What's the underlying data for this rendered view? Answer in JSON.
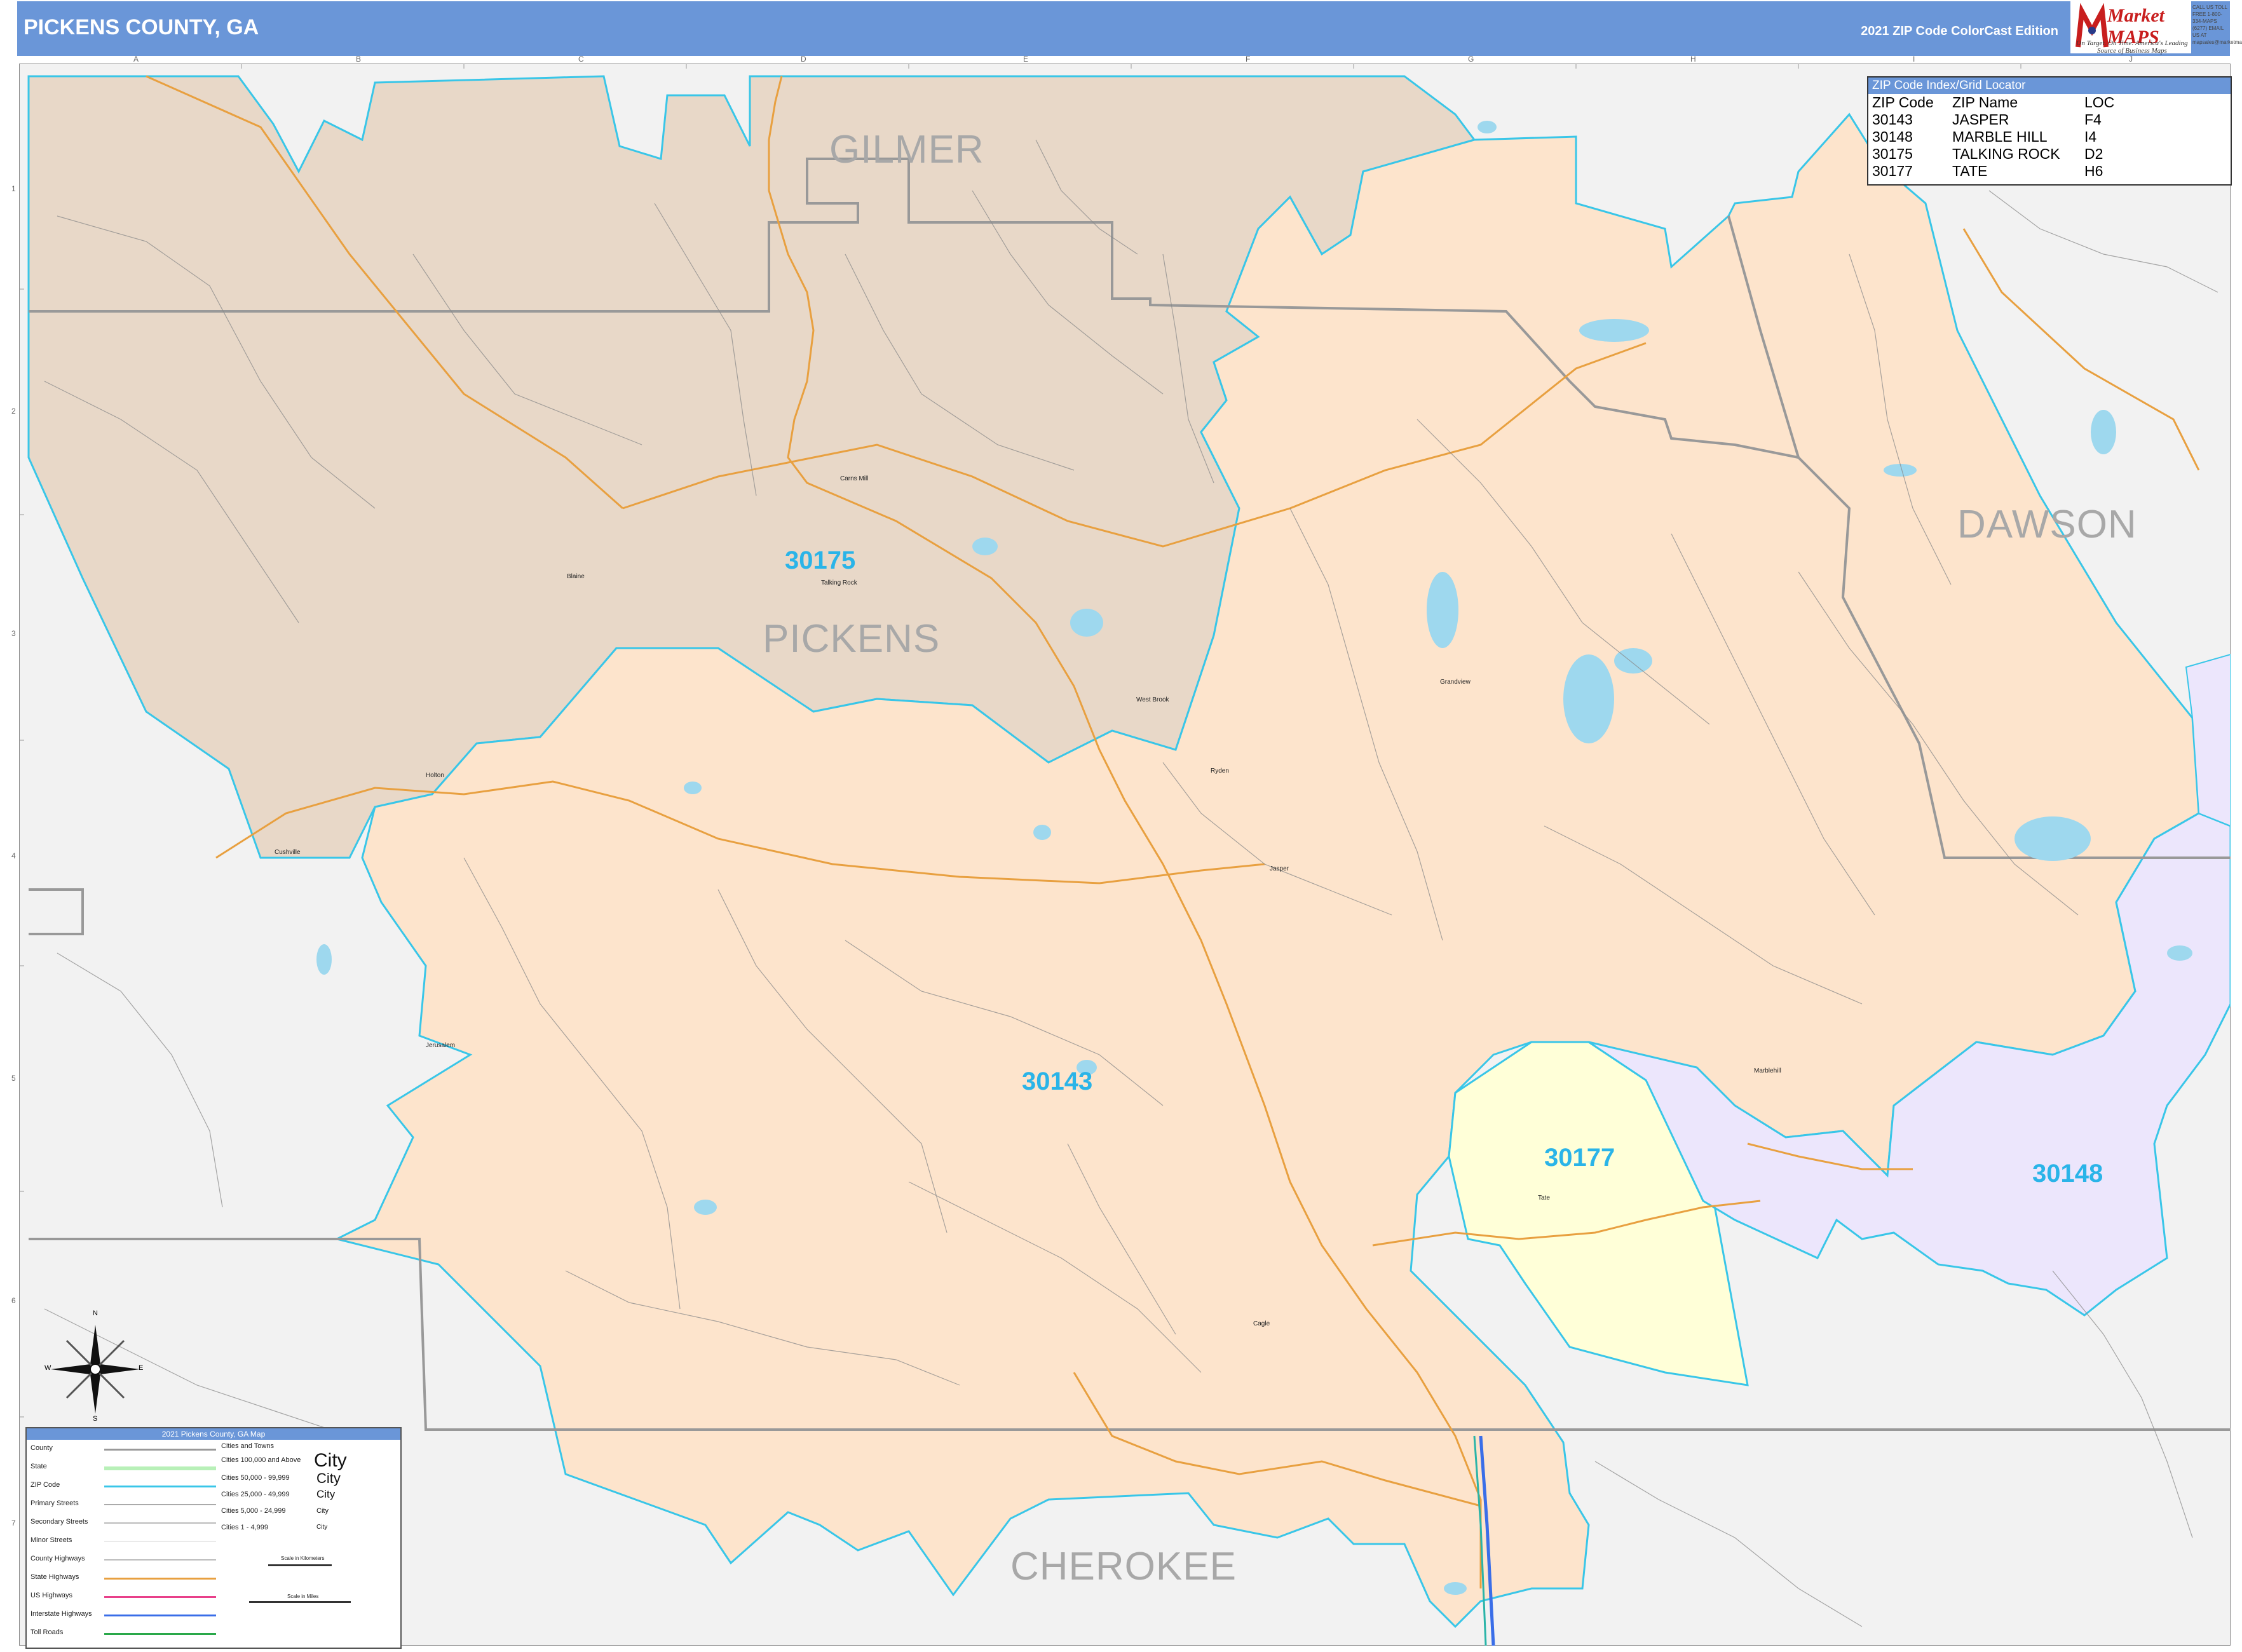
{
  "header": {
    "title": "PICKENS COUNTY, GA",
    "edition": "2021 ZIP Code ColorCast Edition",
    "logo_name": "Market MAPS",
    "logo_tagline": "On Target. On Time. America's Leading Source of Business Maps",
    "logo_contact": "CALL US TOLL FREE 1-800-334-MAPS (6277) EMAIL US AT mapsales@marketmaps.com"
  },
  "colors": {
    "header": "#6a96d8",
    "zip_30175": "#e8d8c8",
    "zip_30143": "#fde4cc",
    "zip_30177": "#ffffd8",
    "zip_30148": "#ece6fc",
    "outside": "#f2f2f2",
    "zip_boundary": "#39c6e8",
    "county_boundary": "#999999",
    "water": "#9ed8ee",
    "state_highway": "#e8a040"
  },
  "grid": {
    "columns": [
      "A",
      "B",
      "C",
      "D",
      "E",
      "F",
      "G",
      "H",
      "I",
      "J"
    ],
    "rows": [
      "1",
      "2",
      "3",
      "4",
      "5",
      "6",
      "7"
    ]
  },
  "counties": {
    "gilmer": "GILMER",
    "pickens": "PICKENS",
    "dawson": "DAWSON",
    "cherokee": "CHEROKEE"
  },
  "zips": {
    "z30175": "30175",
    "z30143": "30143",
    "z30177": "30177",
    "z30148": "30148"
  },
  "places": {
    "carns_mill": "Carns Mill",
    "talking_rock": "Talking Rock",
    "blaine": "Blaine",
    "west_brook": "West Brook",
    "grandview": "Grandview",
    "ryden": "Ryden",
    "jasper": "Jasper",
    "holton": "Holton",
    "cushville": "Cushville",
    "jerusalem": "Jerusalem",
    "marblehill": "Marblehill",
    "tate": "Tate",
    "cagle": "Cagle"
  },
  "zip_index": {
    "title": "ZIP Code Index/Grid Locator",
    "headers": [
      "ZIP Code",
      "ZIP Name",
      "LOC"
    ],
    "rows": [
      [
        "30143",
        "JASPER",
        "F4"
      ],
      [
        "30148",
        "MARBLE HILL",
        "I4"
      ],
      [
        "30175",
        "TALKING ROCK",
        "D2"
      ],
      [
        "30177",
        "TATE",
        "H6"
      ]
    ]
  },
  "legend": {
    "title": "2021 Pickens County, GA Map",
    "items": [
      "County",
      "State",
      "ZIP Code",
      "Primary Streets",
      "Secondary Streets",
      "Minor Streets",
      "County Highways",
      "State Highways",
      "US Highways",
      "Interstate Highways",
      "Toll Roads"
    ],
    "cities_header": "Cities and Towns",
    "city_classes": [
      "Cities 100,000 and Above",
      "Cities 50,000 - 99,999",
      "Cities 25,000 - 49,999",
      "Cities 5,000 - 24,999",
      "Cities 1 - 4,999"
    ],
    "city_sample": "City",
    "scale_km": "Scale in Kilometers",
    "scale_mi": "Scale in Miles"
  },
  "compass": {
    "n": "N",
    "s": "S",
    "e": "E",
    "w": "W"
  }
}
